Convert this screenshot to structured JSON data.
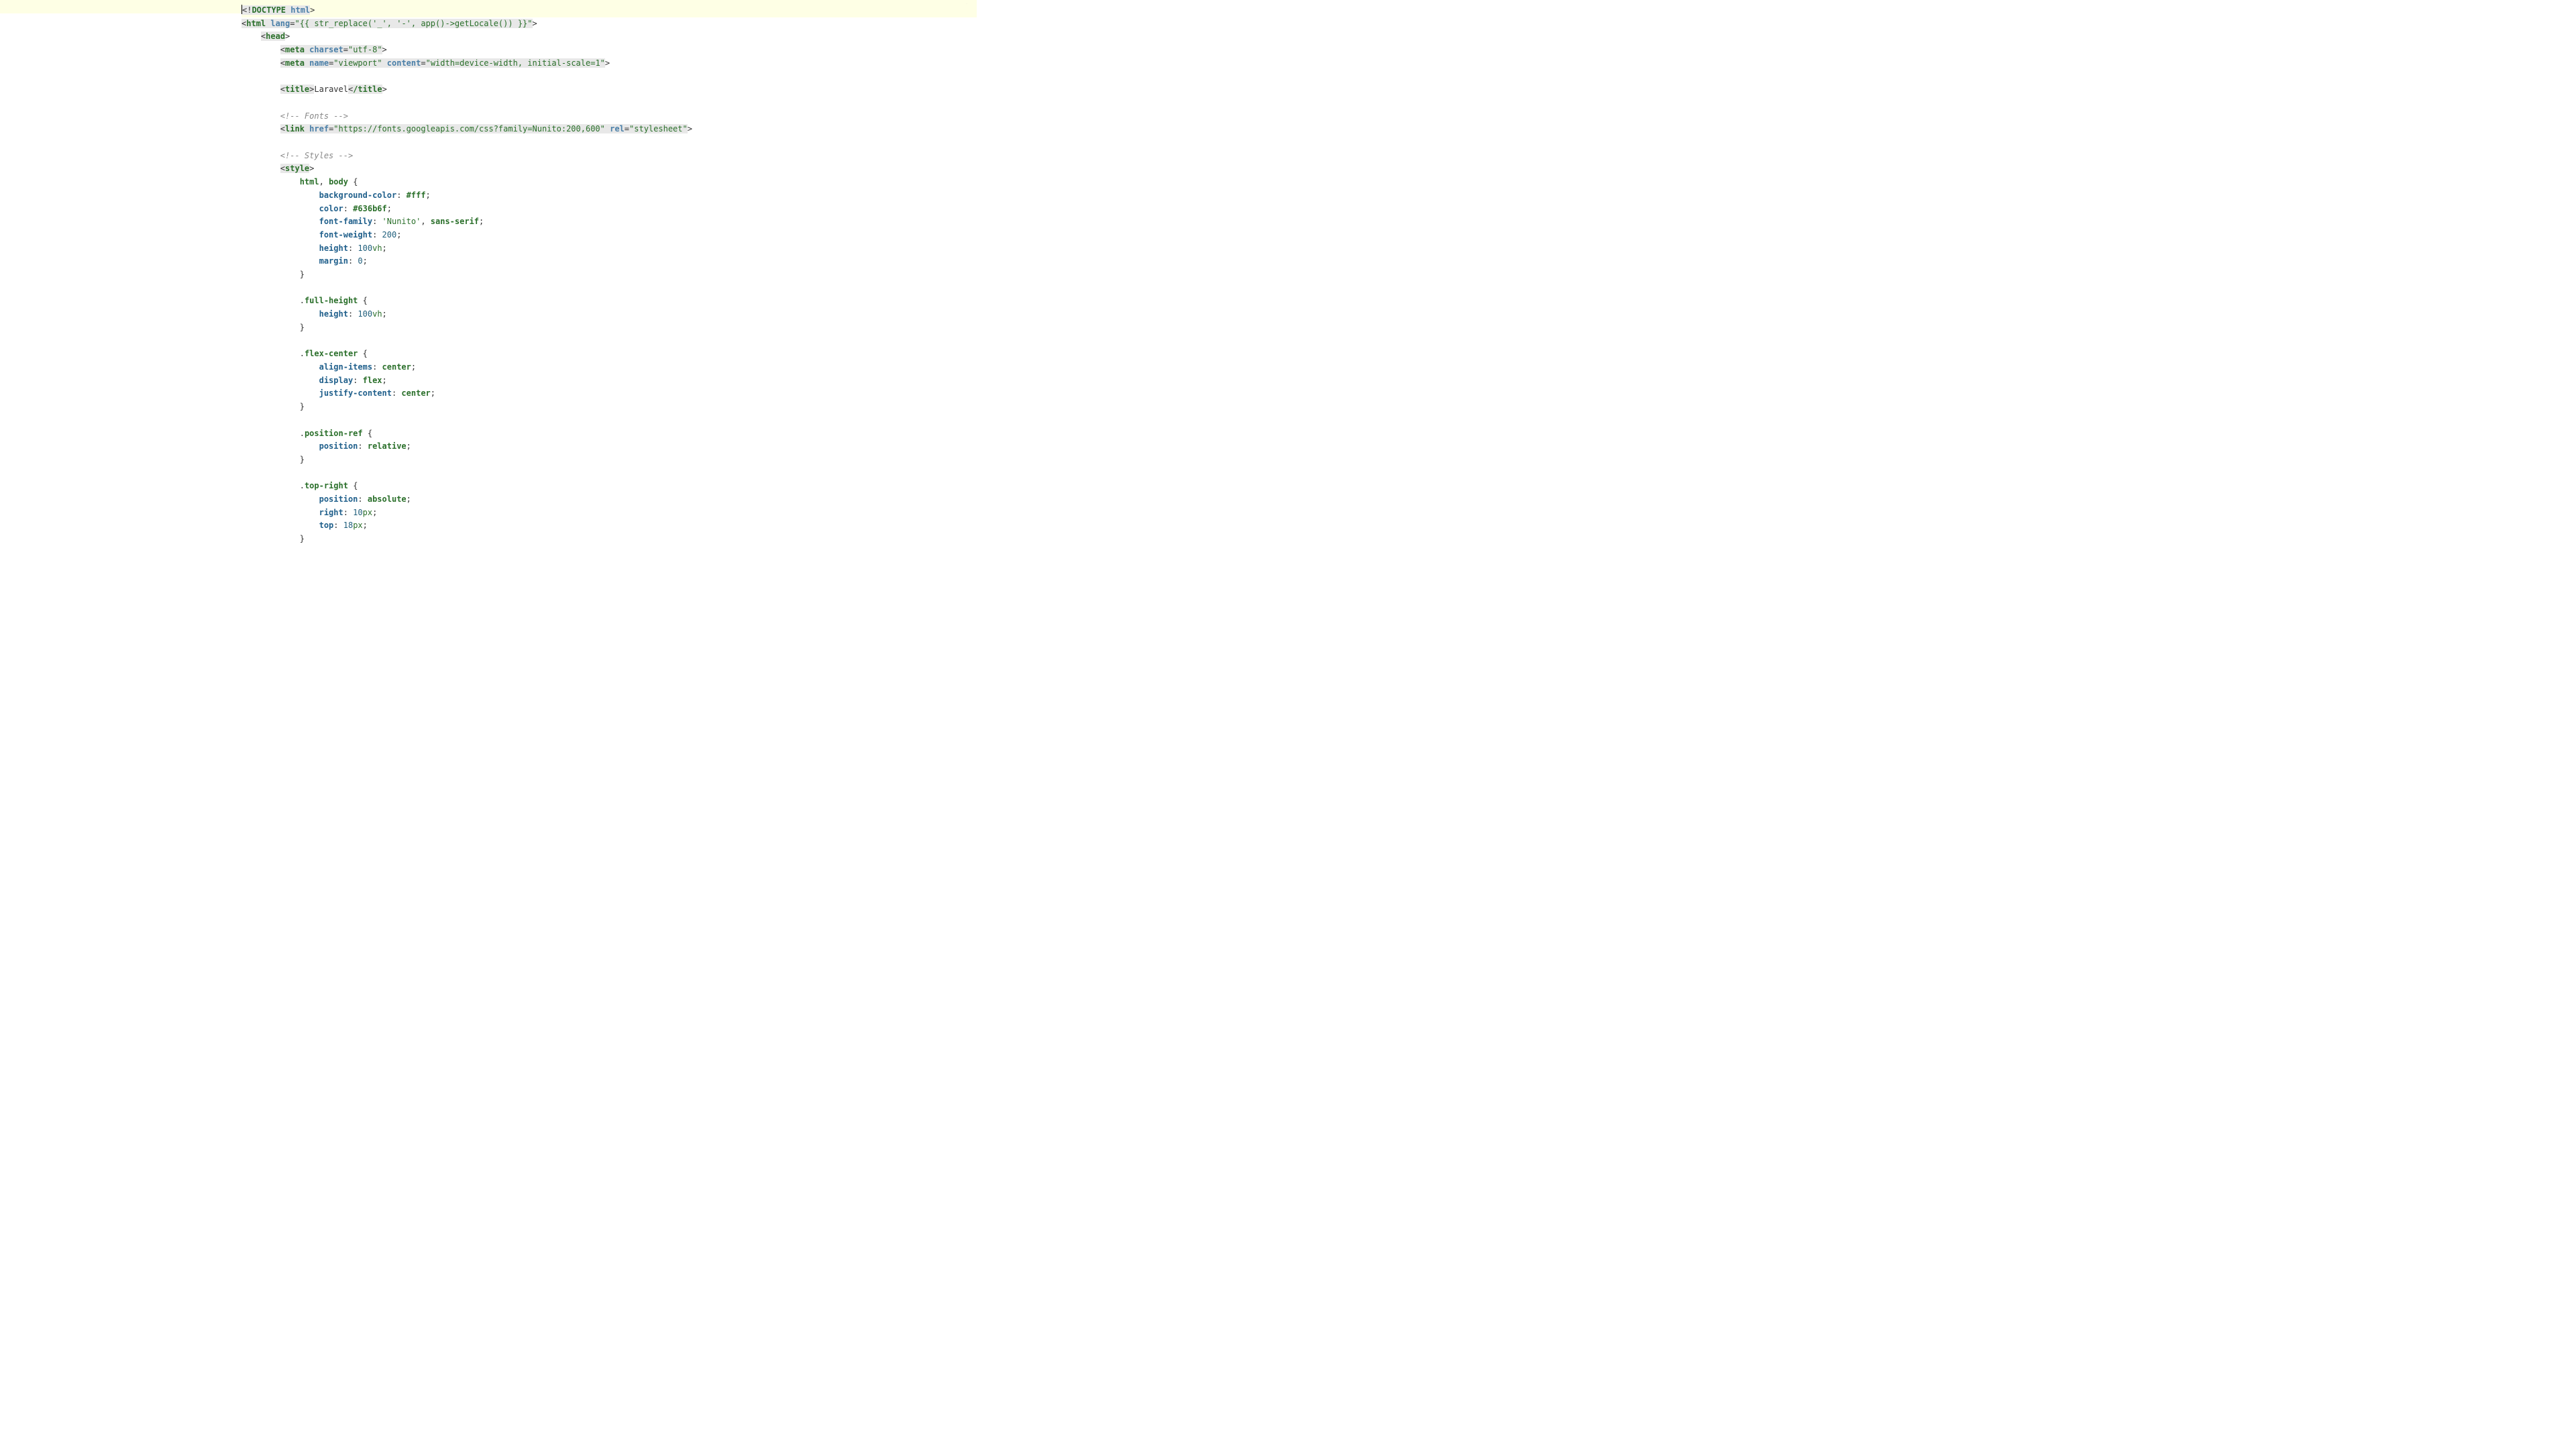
{
  "icons": {
    "eye": "eye"
  },
  "lines": [
    {
      "indent": 0,
      "highlight": true,
      "cursor": true,
      "segs": [
        {
          "t": "<!",
          "c": "tag-bg2 normal"
        },
        {
          "t": "DOCTYPE ",
          "c": "tag-bg2 kw-green"
        },
        {
          "t": "html",
          "c": "tag-bg2 blue"
        },
        {
          "t": ">",
          "c": "normal"
        }
      ]
    },
    {
      "indent": 0,
      "segs": [
        {
          "t": "<",
          "c": "tag-bg2 normal"
        },
        {
          "t": "html ",
          "c": "tag-bg"
        },
        {
          "t": "lang",
          "c": "tag-bg2 blue"
        },
        {
          "t": "=",
          "c": "tag-bg2 normal"
        },
        {
          "t": "\"{{ str_replace('_', '-', app()->getLocale()) }}\"",
          "c": "tag-bg2 str"
        },
        {
          "t": ">",
          "c": "normal"
        }
      ]
    },
    {
      "indent": 1,
      "segs": [
        {
          "t": "<",
          "c": "tag-bg2 normal"
        },
        {
          "t": "head",
          "c": "tag-bg"
        },
        {
          "t": ">",
          "c": "normal"
        }
      ]
    },
    {
      "indent": 2,
      "segs": [
        {
          "t": "<",
          "c": "tag-bg2 normal"
        },
        {
          "t": "meta ",
          "c": "tag-bg"
        },
        {
          "t": "charset",
          "c": "tag-bg2 blue"
        },
        {
          "t": "=",
          "c": "tag-bg2 normal"
        },
        {
          "t": "\"utf-8\"",
          "c": "tag-bg2 str"
        },
        {
          "t": ">",
          "c": "normal"
        }
      ]
    },
    {
      "indent": 2,
      "segs": [
        {
          "t": "<",
          "c": "tag-bg2 normal"
        },
        {
          "t": "meta ",
          "c": "tag-bg"
        },
        {
          "t": "name",
          "c": "tag-bg2 blue"
        },
        {
          "t": "=",
          "c": "tag-bg2 normal"
        },
        {
          "t": "\"viewport\"",
          "c": "tag-bg2 str"
        },
        {
          "t": " ",
          "c": "tag-bg2"
        },
        {
          "t": "content",
          "c": "tag-bg2 blue"
        },
        {
          "t": "=",
          "c": "tag-bg2 normal"
        },
        {
          "t": "\"width=device-width, initial-scale=1\"",
          "c": "tag-bg2 str"
        },
        {
          "t": ">",
          "c": "normal"
        }
      ]
    },
    {
      "indent": 0,
      "segs": [
        {
          "t": "",
          "c": ""
        }
      ]
    },
    {
      "indent": 2,
      "segs": [
        {
          "t": "<",
          "c": "tag-bg2 normal"
        },
        {
          "t": "title",
          "c": "tag-bg"
        },
        {
          "t": ">",
          "c": "tag-bg2 normal"
        },
        {
          "t": "Laravel",
          "c": "normal"
        },
        {
          "t": "<",
          "c": "tag-bg2 normal"
        },
        {
          "t": "/title",
          "c": "tag-bg"
        },
        {
          "t": ">",
          "c": "normal"
        }
      ]
    },
    {
      "indent": 0,
      "segs": [
        {
          "t": "",
          "c": ""
        }
      ]
    },
    {
      "indent": 2,
      "segs": [
        {
          "t": "<!-- Fonts -->",
          "c": "comment"
        }
      ]
    },
    {
      "indent": 2,
      "segs": [
        {
          "t": "<",
          "c": "tag-bg2 normal"
        },
        {
          "t": "link ",
          "c": "tag-bg"
        },
        {
          "t": "href",
          "c": "tag-bg2 blue"
        },
        {
          "t": "=",
          "c": "tag-bg2 normal"
        },
        {
          "t": "\"https://fonts.googleapis.com/css?family=Nunito:200,600\"",
          "c": "tag-bg2 str"
        },
        {
          "t": " ",
          "c": "tag-bg2"
        },
        {
          "t": "rel",
          "c": "tag-bg2 blue"
        },
        {
          "t": "=",
          "c": "tag-bg2 normal"
        },
        {
          "t": "\"stylesheet\"",
          "c": "tag-bg2 str"
        },
        {
          "t": ">",
          "c": "normal"
        }
      ]
    },
    {
      "indent": 0,
      "segs": [
        {
          "t": "",
          "c": ""
        }
      ]
    },
    {
      "indent": 2,
      "segs": [
        {
          "t": "<!-- Styles -->",
          "c": "comment"
        }
      ]
    },
    {
      "indent": 2,
      "segs": [
        {
          "t": "<",
          "c": "tag-bg2 normal"
        },
        {
          "t": "style",
          "c": "tag-bg"
        },
        {
          "t": ">",
          "c": "normal"
        }
      ]
    },
    {
      "indent": 3,
      "segs": [
        {
          "t": "html",
          "c": "kw-green"
        },
        {
          "t": ", ",
          "c": "normal"
        },
        {
          "t": "body",
          "c": "kw-green"
        },
        {
          "t": " {",
          "c": "normal"
        }
      ]
    },
    {
      "indent": 4,
      "segs": [
        {
          "t": "background-color",
          "c": "navy"
        },
        {
          "t": ": ",
          "c": "normal"
        },
        {
          "t": "#fff",
          "c": "kw-green"
        },
        {
          "t": ";",
          "c": "normal"
        }
      ]
    },
    {
      "indent": 4,
      "segs": [
        {
          "t": "color",
          "c": "navy"
        },
        {
          "t": ": ",
          "c": "normal"
        },
        {
          "t": "#636b6f",
          "c": "kw-green"
        },
        {
          "t": ";",
          "c": "normal"
        }
      ]
    },
    {
      "indent": 4,
      "segs": [
        {
          "t": "font-family",
          "c": "navy"
        },
        {
          "t": ": ",
          "c": "normal"
        },
        {
          "t": "'Nunito'",
          "c": "str"
        },
        {
          "t": ", ",
          "c": "normal"
        },
        {
          "t": "sans-serif",
          "c": "kw-green"
        },
        {
          "t": ";",
          "c": "normal"
        }
      ]
    },
    {
      "indent": 4,
      "segs": [
        {
          "t": "font-weight",
          "c": "navy"
        },
        {
          "t": ": ",
          "c": "normal"
        },
        {
          "t": "200",
          "c": "num"
        },
        {
          "t": ";",
          "c": "normal"
        }
      ]
    },
    {
      "indent": 4,
      "segs": [
        {
          "t": "height",
          "c": "navy"
        },
        {
          "t": ": ",
          "c": "normal"
        },
        {
          "t": "100",
          "c": "num"
        },
        {
          "t": "vh",
          "c": "unit"
        },
        {
          "t": ";",
          "c": "normal"
        }
      ]
    },
    {
      "indent": 4,
      "segs": [
        {
          "t": "margin",
          "c": "navy"
        },
        {
          "t": ": ",
          "c": "normal"
        },
        {
          "t": "0",
          "c": "num"
        },
        {
          "t": ";",
          "c": "normal"
        }
      ]
    },
    {
      "indent": 3,
      "segs": [
        {
          "t": "}",
          "c": "normal"
        }
      ]
    },
    {
      "indent": 0,
      "segs": [
        {
          "t": "",
          "c": ""
        }
      ]
    },
    {
      "indent": 3,
      "segs": [
        {
          "t": ".",
          "c": "normal"
        },
        {
          "t": "full-height",
          "c": "kw-green"
        },
        {
          "t": " {",
          "c": "normal"
        }
      ]
    },
    {
      "indent": 4,
      "segs": [
        {
          "t": "height",
          "c": "navy"
        },
        {
          "t": ": ",
          "c": "normal"
        },
        {
          "t": "100",
          "c": "num"
        },
        {
          "t": "vh",
          "c": "unit"
        },
        {
          "t": ";",
          "c": "normal"
        }
      ]
    },
    {
      "indent": 3,
      "segs": [
        {
          "t": "}",
          "c": "normal"
        }
      ]
    },
    {
      "indent": 0,
      "segs": [
        {
          "t": "",
          "c": ""
        }
      ]
    },
    {
      "indent": 3,
      "segs": [
        {
          "t": ".",
          "c": "normal"
        },
        {
          "t": "flex-center",
          "c": "kw-green"
        },
        {
          "t": " {",
          "c": "normal"
        }
      ]
    },
    {
      "indent": 4,
      "segs": [
        {
          "t": "align-items",
          "c": "navy"
        },
        {
          "t": ": ",
          "c": "normal"
        },
        {
          "t": "center",
          "c": "kw-green"
        },
        {
          "t": ";",
          "c": "normal"
        }
      ]
    },
    {
      "indent": 4,
      "segs": [
        {
          "t": "display",
          "c": "navy"
        },
        {
          "t": ": ",
          "c": "normal"
        },
        {
          "t": "flex",
          "c": "kw-green"
        },
        {
          "t": ";",
          "c": "normal"
        }
      ]
    },
    {
      "indent": 4,
      "segs": [
        {
          "t": "justify-content",
          "c": "navy"
        },
        {
          "t": ": ",
          "c": "normal"
        },
        {
          "t": "center",
          "c": "kw-green"
        },
        {
          "t": ";",
          "c": "normal"
        }
      ]
    },
    {
      "indent": 3,
      "segs": [
        {
          "t": "}",
          "c": "normal"
        }
      ]
    },
    {
      "indent": 0,
      "segs": [
        {
          "t": "",
          "c": ""
        }
      ]
    },
    {
      "indent": 3,
      "segs": [
        {
          "t": ".",
          "c": "normal"
        },
        {
          "t": "position-ref",
          "c": "kw-green"
        },
        {
          "t": " {",
          "c": "normal"
        }
      ]
    },
    {
      "indent": 4,
      "segs": [
        {
          "t": "position",
          "c": "navy"
        },
        {
          "t": ": ",
          "c": "normal"
        },
        {
          "t": "relative",
          "c": "kw-green"
        },
        {
          "t": ";",
          "c": "normal"
        }
      ]
    },
    {
      "indent": 3,
      "segs": [
        {
          "t": "}",
          "c": "normal"
        }
      ]
    },
    {
      "indent": 0,
      "segs": [
        {
          "t": "",
          "c": ""
        }
      ]
    },
    {
      "indent": 3,
      "segs": [
        {
          "t": ".",
          "c": "normal"
        },
        {
          "t": "top-right",
          "c": "kw-green"
        },
        {
          "t": " {",
          "c": "normal"
        }
      ]
    },
    {
      "indent": 4,
      "segs": [
        {
          "t": "position",
          "c": "navy"
        },
        {
          "t": ": ",
          "c": "normal"
        },
        {
          "t": "absolute",
          "c": "kw-green"
        },
        {
          "t": ";",
          "c": "normal"
        }
      ]
    },
    {
      "indent": 4,
      "segs": [
        {
          "t": "right",
          "c": "navy"
        },
        {
          "t": ": ",
          "c": "normal"
        },
        {
          "t": "10",
          "c": "num"
        },
        {
          "t": "px",
          "c": "unit"
        },
        {
          "t": ";",
          "c": "normal"
        }
      ]
    },
    {
      "indent": 4,
      "segs": [
        {
          "t": "top",
          "c": "navy"
        },
        {
          "t": ": ",
          "c": "normal"
        },
        {
          "t": "18",
          "c": "num"
        },
        {
          "t": "px",
          "c": "unit"
        },
        {
          "t": ";",
          "c": "normal"
        }
      ]
    },
    {
      "indent": 3,
      "segs": [
        {
          "t": "}",
          "c": "normal"
        }
      ]
    }
  ]
}
